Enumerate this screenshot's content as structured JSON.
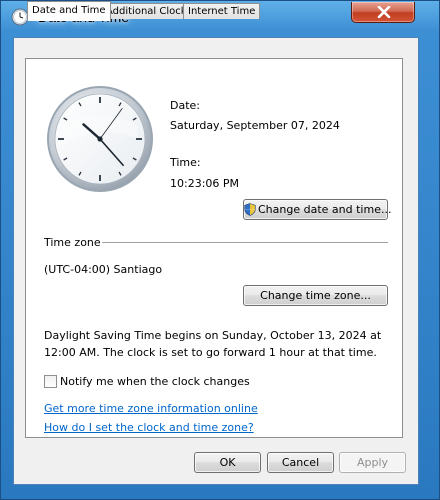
{
  "window": {
    "title": "Date and Time"
  },
  "tabs": [
    {
      "label": "Date and Time",
      "active": true
    },
    {
      "label": "Additional Clocks",
      "active": false
    },
    {
      "label": "Internet Time",
      "active": false
    }
  ],
  "clock": {
    "hours": 10,
    "minutes": 23,
    "seconds": 6
  },
  "date": {
    "label": "Date:",
    "value": "Saturday, September 07, 2024"
  },
  "time": {
    "label": "Time:",
    "value": "10:23:06 PM"
  },
  "buttons": {
    "change_date_time": "Change date and time...",
    "change_time_zone": "Change time zone...",
    "ok": "OK",
    "cancel": "Cancel",
    "apply": "Apply"
  },
  "timezone": {
    "heading": "Time zone",
    "value": "(UTC-04:00) Santiago"
  },
  "dst": {
    "description": "Daylight Saving Time begins on Sunday, October 13, 2024 at 12:00 AM. The clock is set to go forward 1 hour at that time."
  },
  "notify": {
    "label": "Notify me when the clock changes",
    "checked": false
  },
  "links": {
    "more_info": "Get more time zone information online",
    "how_to": "How do I set the clock and time zone?"
  },
  "colors": {
    "titlebar": "#3d8fd4",
    "close": "#c13d1f",
    "link": "#0066cc"
  }
}
